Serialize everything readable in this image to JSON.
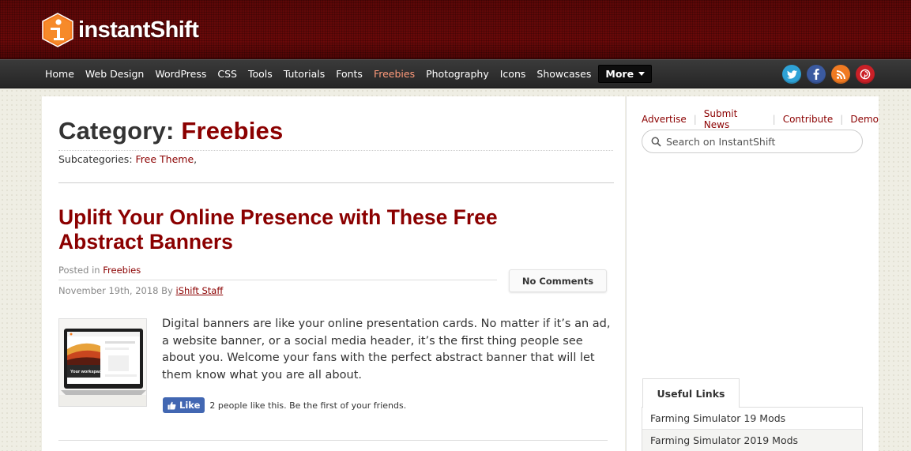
{
  "brand": {
    "name": "instantShift",
    "accent": "#8b0000",
    "logo_color": "#f47b20"
  },
  "nav": {
    "items": [
      "Home",
      "Web Design",
      "WordPress",
      "CSS",
      "Tools",
      "Tutorials",
      "Fonts",
      "Freebies",
      "Photography",
      "Icons",
      "Showcases"
    ],
    "active": "Freebies",
    "more_label": "More"
  },
  "social": [
    {
      "icon": "twitter-icon",
      "color": "#2ea2d6"
    },
    {
      "icon": "facebook-icon",
      "color": "#3b5aa0"
    },
    {
      "icon": "rss-icon",
      "color": "#f07a22"
    },
    {
      "icon": "pinterest-icon",
      "color": "#cb2027"
    }
  ],
  "category": {
    "prefix": "Category:",
    "name": "Freebies",
    "subcategories_label": "Subcategories:",
    "subcategory": "Free Theme",
    "subcategory_suffix": ","
  },
  "post": {
    "title": "Uplift Your Online Presence with These Free Abstract Banners",
    "posted_in_label": "Posted in",
    "posted_in": "Freebies",
    "date": "November 19th, 2018 By",
    "author": "iShift Staff",
    "comments_label": "No Comments",
    "excerpt": "Digital banners are like your online presentation cards. No matter if it’s an ad, a website banner, or a social media header, it’s the first thing people see about you. Welcome your fans with the perfect abstract banner that will let them know what you are all about.",
    "thumb_caption": "Your workspace",
    "like_label": "Like",
    "like_text": "2 people like this. Be the first of your friends."
  },
  "sidebar": {
    "top_links": [
      "Advertise",
      "Submit News",
      "Contribute",
      "Demo"
    ],
    "search_placeholder": "Search on InstantShift",
    "useful_title": "Useful Links",
    "useful_links": [
      "Farming Simulator 19 Mods",
      "Farming Simulator 2019 Mods"
    ]
  }
}
